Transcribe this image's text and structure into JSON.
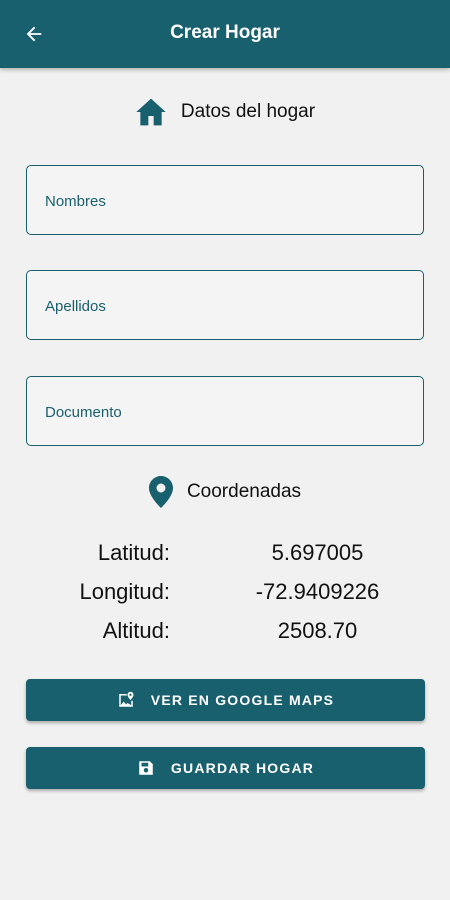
{
  "appbar": {
    "title": "Crear Hogar",
    "back_icon": "arrow-left-icon",
    "color": "#19606e"
  },
  "household_section": {
    "icon": "home-icon",
    "label": "Datos del hogar"
  },
  "form": {
    "nombres": {
      "value": "",
      "placeholder": "Nombres"
    },
    "apellidos": {
      "value": "",
      "placeholder": "Apellidos"
    },
    "documento": {
      "value": "",
      "placeholder": "Documento"
    }
  },
  "coordinates_section": {
    "icon": "map-pin-icon",
    "label": "Coordenadas"
  },
  "coordinates": {
    "latitud_label": "Latitud:",
    "latitud_value": "5.697005",
    "longitud_label": "Longitud:",
    "longitud_value": "-72.9409226",
    "altitud_label": "Altitud:",
    "altitud_value": "2508.70"
  },
  "buttons": {
    "maps_label": "VER EN GOOGLE MAPS",
    "maps_icon": "map-location-icon",
    "save_label": "GUARDAR HOGAR",
    "save_icon": "save-icon"
  }
}
